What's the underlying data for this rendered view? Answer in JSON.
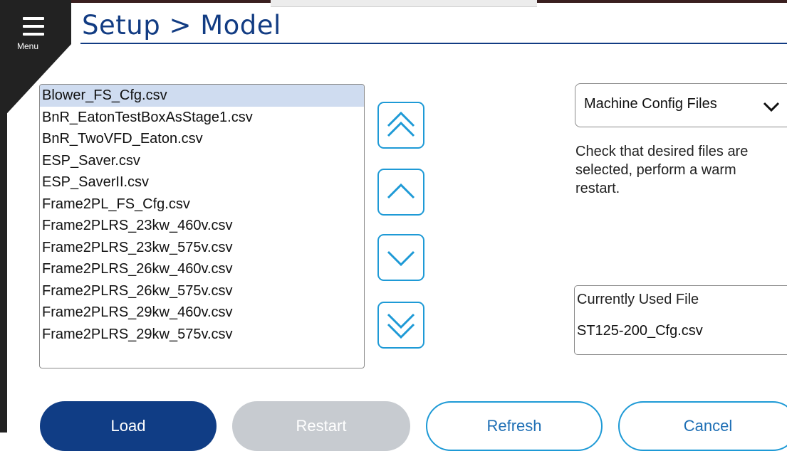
{
  "menu": {
    "label": "Menu"
  },
  "header": {
    "title": "Setup > Model"
  },
  "file_list": {
    "selected_index": 0,
    "items": [
      "Blower_FS_Cfg.csv",
      "BnR_EatonTestBoxAsStage1.csv",
      "BnR_TwoVFD_Eaton.csv",
      "ESP_Saver.csv",
      "ESP_SaverII.csv",
      "Frame2PL_FS_Cfg.csv",
      "Frame2PLRS_23kw_460v.csv",
      "Frame2PLRS_23kw_575v.csv",
      "Frame2PLRS_26kw_460v.csv",
      "Frame2PLRS_26kw_575v.csv",
      "Frame2PLRS_29kw_460v.csv",
      "Frame2PLRS_29kw_575v.csv"
    ]
  },
  "nav_buttons": {
    "page_up_icon": "double-chevron-up-icon",
    "up_icon": "chevron-up-icon",
    "down_icon": "chevron-down-icon",
    "page_down_icon": "double-chevron-down-icon"
  },
  "file_type_select": {
    "value": "Machine Config Files",
    "icon": "chevron-down-icon"
  },
  "instructions": "Check that desired files are selected, perform a warm restart.",
  "current_file": {
    "label": "Currently Used File",
    "value": "ST125-200_Cfg.csv"
  },
  "actions": {
    "load": "Load",
    "restart": "Restart",
    "refresh": "Refresh",
    "cancel": "Cancel"
  },
  "colors": {
    "brand_navy": "#103d85",
    "accent_blue": "#1e9ad6",
    "disabled_gray": "#c7cbd0",
    "selected_row": "#cfdcf0"
  }
}
